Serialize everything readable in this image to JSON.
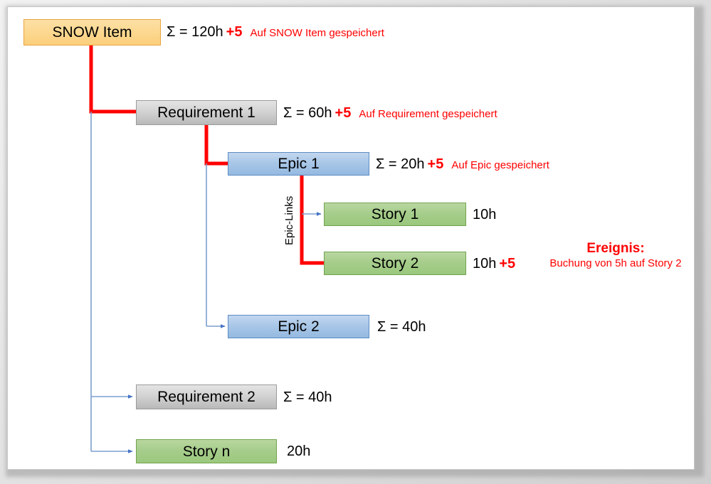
{
  "diagram": {
    "type": "hierarchy-rollup-diagram",
    "colors": {
      "highlight_path": "#ff0000",
      "normal_link": "#7c9fcf",
      "snow_item_fill": "#fbcf7c",
      "requirement_fill": "#d3d3d3",
      "epic_fill": "#a9c7e8",
      "story_fill": "#a7cd8c",
      "annotation_red": "#ff0000"
    },
    "nodes": [
      {
        "id": "snow_item",
        "label": "SNOW Item",
        "style": "orange",
        "sum": "Σ = 120h",
        "delta": "+5",
        "note": "Auf SNOW Item gespeichert"
      },
      {
        "id": "requirement_1",
        "label": "Requirement 1",
        "style": "gray",
        "sum": "Σ = 60h",
        "delta": "+5",
        "note": "Auf Requirement gespeichert"
      },
      {
        "id": "epic_1",
        "label": "Epic 1",
        "style": "blue",
        "sum": "Σ = 20h",
        "delta": "+5",
        "note": "Auf Epic gespeichert"
      },
      {
        "id": "story_1",
        "label": "Story 1",
        "style": "green",
        "hours": "10h",
        "delta": "",
        "note": ""
      },
      {
        "id": "story_2",
        "label": "Story 2",
        "style": "green",
        "hours": "10h",
        "delta": "+5",
        "note": ""
      },
      {
        "id": "epic_2",
        "label": "Epic 2",
        "style": "blue",
        "sum": "Σ = 40h",
        "delta": "",
        "note": ""
      },
      {
        "id": "requirement_2",
        "label": "Requirement 2",
        "style": "gray",
        "sum": "Σ = 40h",
        "delta": "",
        "note": ""
      },
      {
        "id": "story_n",
        "label": "Story n",
        "style": "green",
        "hours": "20h",
        "delta": "",
        "note": ""
      }
    ],
    "edge_labels": [
      {
        "id": "epic_links",
        "label": "Epic-Links"
      }
    ],
    "event": {
      "title": "Ereignis:",
      "body": "Buchung von 5h auf Story 2"
    }
  }
}
